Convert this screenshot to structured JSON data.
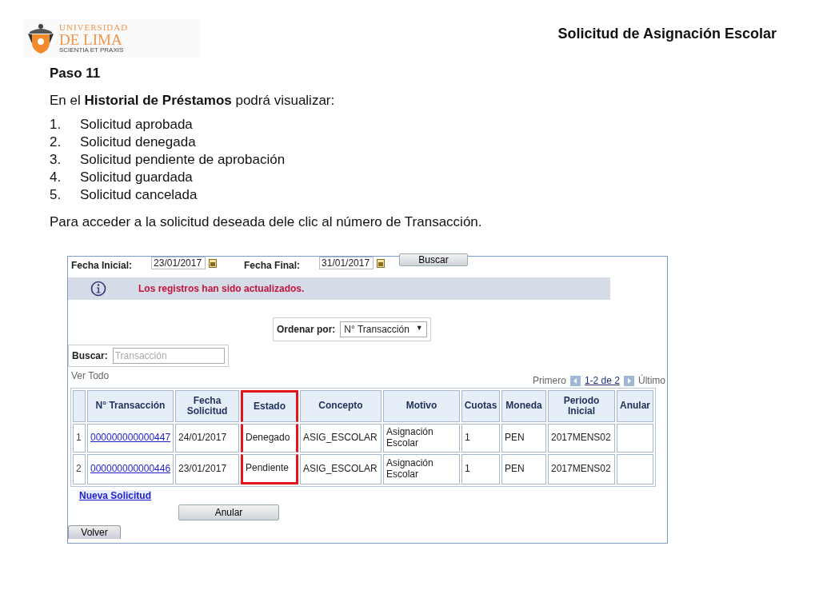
{
  "logo": {
    "line1": "UNIVERSIDAD",
    "line2": "DE LIMA",
    "motto": "SCIENTIA ET PRAXIS"
  },
  "title": "Solicitud de Asignación Escolar",
  "step": "Paso 11",
  "intro": "En el **Historial de Préstamos**  podrá visualizar:",
  "list": [
    {
      "num": "1.",
      "text": "Solicitud aprobada"
    },
    {
      "num": "2.",
      "text": "Solicitud denegada"
    },
    {
      "num": "3.",
      "text": "Solicitud pendiente de aprobación"
    },
    {
      "num": "4.",
      "text": "Solicitud guardada"
    },
    {
      "num": "5.",
      "text": "Solicitud cancelada"
    }
  ],
  "instruction": "Para acceder a la solicitud deseada dele clic al número de Transacción.",
  "app": {
    "date_from": {
      "label": "Fecha Inicial:",
      "value": "23/01/2017"
    },
    "date_to": {
      "label": "Fecha Final:",
      "value": "31/01/2017"
    },
    "search_button": "Buscar",
    "message": "Los registros han sido actualizados.",
    "sort": {
      "label": "Ordenar por:",
      "value": "N° Transacción",
      "caret": "▼"
    },
    "search": {
      "label": "Buscar:",
      "placeholder": "Transacción"
    },
    "view_all": "Ver Todo",
    "pager": {
      "first": "Primero",
      "range": "1-2 de 2",
      "last": "Último"
    },
    "columns": [
      {
        "highlighted": false
      },
      {
        "label": "N° Transacción",
        "highlighted": false
      },
      {
        "label": "Fecha Solicitud",
        "highlighted": false
      },
      {
        "label": "Estado",
        "highlighted": true
      },
      {
        "label": "Concepto",
        "highlighted": false
      },
      {
        "label": "Motivo",
        "highlighted": false
      },
      {
        "label": "Cuotas",
        "highlighted": false
      },
      {
        "label": "Moneda",
        "highlighted": false
      },
      {
        "label": "Periodo Inicial",
        "highlighted": false
      },
      {
        "label": "Anular",
        "highlighted": false
      }
    ],
    "rows": [
      [
        "1",
        "000000000000447",
        "24/01/2017",
        "Denegado",
        "ASIG_ESCOLAR",
        "Asignación Escolar",
        "1",
        "PEN",
        "2017MENS02",
        ""
      ],
      [
        "2",
        "000000000000446",
        "23/01/2017",
        "Pendiente",
        "ASIG_ESCOLAR",
        "Asignación Escolar",
        "1",
        "PEN",
        "2017MENS02",
        ""
      ]
    ],
    "new_link": "Nueva Solicitud",
    "cancel_button": "Anular",
    "back_tab": "Volver"
  }
}
